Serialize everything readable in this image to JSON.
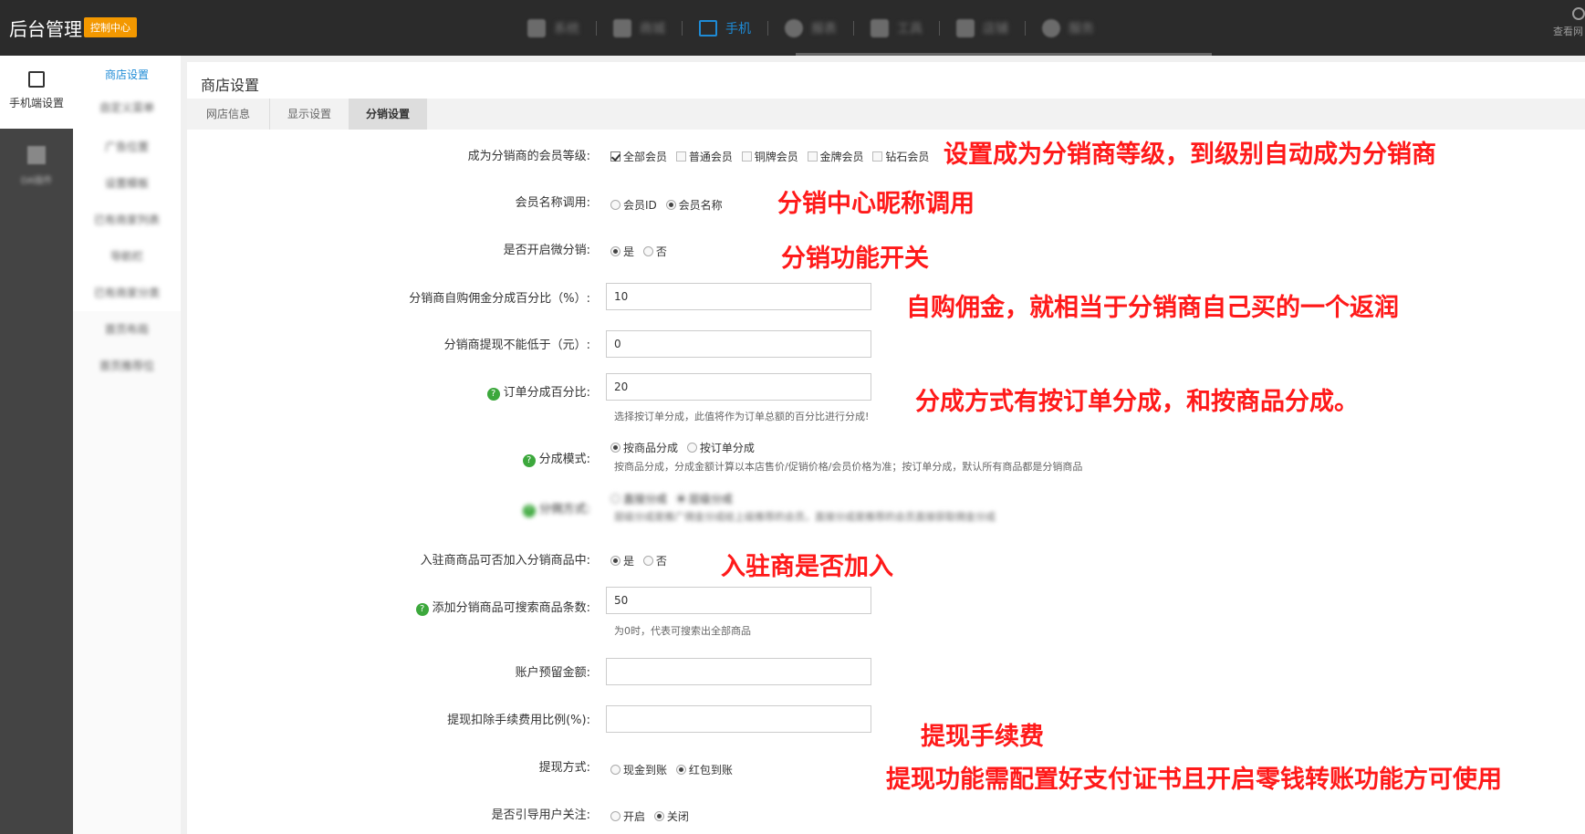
{
  "topbar": {
    "brand": "后台管理",
    "badge": "控制中心",
    "nav": [
      {
        "label": "系统"
      },
      {
        "label": "商城"
      },
      {
        "label": "手机"
      },
      {
        "label": "报表"
      },
      {
        "label": "工具"
      },
      {
        "label": "店铺"
      },
      {
        "label": "服务"
      }
    ],
    "right_label": "查看网"
  },
  "leftnav": {
    "active_label": "手机端设置",
    "second_label": "DA插件"
  },
  "subnav": {
    "items": [
      "商店设置",
      "自定义菜单",
      "广告位置",
      "设置模板",
      "已有商家列表",
      "导航栏",
      "已有商家分类",
      "首页布局",
      "首页推荐位"
    ]
  },
  "main": {
    "title": "商店设置",
    "tabs": [
      "网店信息",
      "显示设置",
      "分销设置"
    ]
  },
  "form": {
    "member_level": {
      "label": "成为分销商的会员等级:",
      "options": [
        {
          "label": "全部会员",
          "checked": true
        },
        {
          "label": "普通会员",
          "checked": false
        },
        {
          "label": "铜牌会员",
          "checked": false
        },
        {
          "label": "金牌会员",
          "checked": false
        },
        {
          "label": "钻石会员",
          "checked": false
        }
      ]
    },
    "member_name": {
      "label": "会员名称调用:",
      "options": [
        {
          "label": "会员ID",
          "checked": false
        },
        {
          "label": "会员名称",
          "checked": true
        }
      ]
    },
    "micro_dist": {
      "label": "是否开启微分销:",
      "options": [
        {
          "label": "是",
          "checked": true
        },
        {
          "label": "否",
          "checked": false
        }
      ]
    },
    "self_buy": {
      "label": "分销商自购佣金分成百分比（%）:",
      "value": "10"
    },
    "min_withdraw": {
      "label": "分销商提现不能低于（元）:",
      "value": "0"
    },
    "order_percent": {
      "label": "订单分成百分比:",
      "value": "20",
      "hint": "选择按订单分成，此值将作为订单总额的百分比进行分成!"
    },
    "split_mode": {
      "label": "分成模式:",
      "options": [
        {
          "label": "按商品分成",
          "checked": true
        },
        {
          "label": "按订单分成",
          "checked": false
        }
      ],
      "hint": "按商品分成，分成金额计算以本店售价/促销价格/会员价格为准；按订单分成，默认所有商品都是分销商品"
    },
    "blurred_row": {
      "label": "分佣方式:",
      "options": [
        {
          "label": "直接分成",
          "checked": false
        },
        {
          "label": "层级分成",
          "checked": true
        }
      ],
      "hint": "层级分成是推广佣金分成给上级推荐的会员，直接分成是推荐的会员直接获取佣金分成"
    },
    "merchant_join": {
      "label": "入驻商商品可否加入分销商品中:",
      "options": [
        {
          "label": "是",
          "checked": true
        },
        {
          "label": "否",
          "checked": false
        }
      ]
    },
    "search_count": {
      "label": "添加分销商品可搜索商品条数:",
      "value": "50",
      "hint": "为0时，代表可搜索出全部商品"
    },
    "reserve": {
      "label": "账户预留金额:",
      "value": ""
    },
    "fee_rate": {
      "label": "提现扣除手续费用比例(%):",
      "value": ""
    },
    "withdraw_method": {
      "label": "提现方式:",
      "options": [
        {
          "label": "现金到账",
          "checked": false
        },
        {
          "label": "红包到账",
          "checked": true
        }
      ]
    },
    "follow": {
      "label": "是否引导用户关注:",
      "options": [
        {
          "label": "开启",
          "checked": false
        },
        {
          "label": "关闭",
          "checked": true
        }
      ]
    }
  },
  "annotations": [
    "设置成为分销商等级，到级别自动成为分销商",
    "分销中心昵称调用",
    "分销功能开关",
    "自购佣金，就相当于分销商自己买的一个返润",
    "分成方式有按订单分成，和按商品分成。",
    "入驻商是否加入",
    "提现手续费",
    "提现功能需配置好支付证书且开启零钱转账功能方可使用"
  ],
  "colors": {
    "topbar_bg": "#2b2b2b",
    "accent": "#1e8bd6",
    "badge": "#f39800",
    "annotation": "#ff1a1a"
  }
}
